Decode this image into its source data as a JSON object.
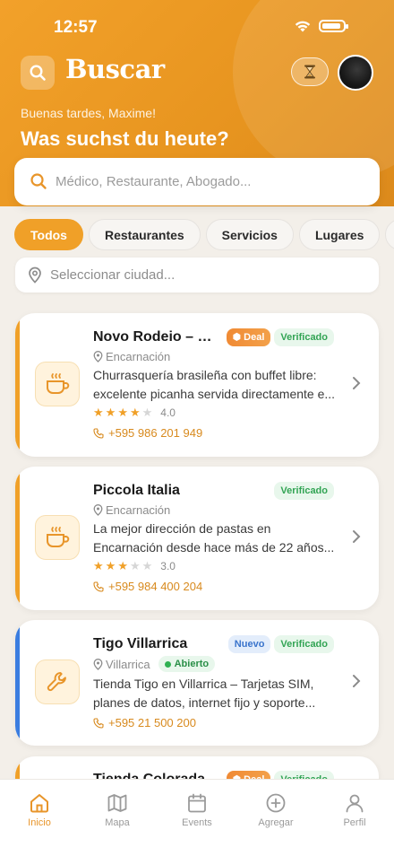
{
  "status": {
    "time": "12:57"
  },
  "header": {
    "title": "Buscar",
    "greeting": "Buenas tardes, Maxime!",
    "headline": "Was suchst du heute?"
  },
  "search": {
    "placeholder": "Médico, Restaurante, Abogado..."
  },
  "chips": [
    {
      "label": "Todos",
      "active": true
    },
    {
      "label": "Restaurantes"
    },
    {
      "label": "Servicios"
    },
    {
      "label": "Lugares"
    },
    {
      "label": "A"
    }
  ],
  "city": {
    "placeholder": "Seleccionar ciudad..."
  },
  "listings": [
    {
      "name": "Novo Rodeio – Re...",
      "badge_deal": "Deal",
      "badge_verified": "Verificado",
      "location": "Encarnación",
      "description": "Churrasquería brasileña con buffet libre: excelente picanha servida directamente e...",
      "rating": "4.0",
      "stars": 4,
      "phone": "+595 986 201 949",
      "icon": "coffee-cup-icon"
    },
    {
      "name": "Piccola Italia",
      "badge_verified": "Verificado",
      "location": "Encarnación",
      "description": "La mejor dirección de pastas en Encarnación desde hace más de 22 años...",
      "rating": "3.0",
      "stars": 3,
      "phone": "+595 984 400 204",
      "icon": "coffee-cup-icon"
    },
    {
      "name": "Tigo Villarrica",
      "badge_new": "Nuevo",
      "badge_verified": "Verificado",
      "location": "Villarrica",
      "open_label": "Abierto",
      "description": "Tienda Tigo en Villarrica – Tarjetas SIM, planes de datos, internet fijo y soporte...",
      "phone": "+595 21 500 200",
      "icon": "wrench-icon"
    },
    {
      "name": "Tienda Colorada C...",
      "badge_deal": "Deal",
      "badge_verified": "Verificado"
    }
  ],
  "tabs": [
    {
      "label": "Inicio",
      "icon": "home-icon",
      "active": true
    },
    {
      "label": "Mapa",
      "icon": "map-icon"
    },
    {
      "label": "Events",
      "icon": "calendar-icon"
    },
    {
      "label": "Agregar",
      "icon": "plus-circle-icon"
    },
    {
      "label": "Perfil",
      "icon": "user-icon"
    }
  ],
  "colors": {
    "accent": "#f0a028",
    "verified": "#32a454",
    "new": "#3a74cc",
    "services_bar": "#3a7de0"
  }
}
